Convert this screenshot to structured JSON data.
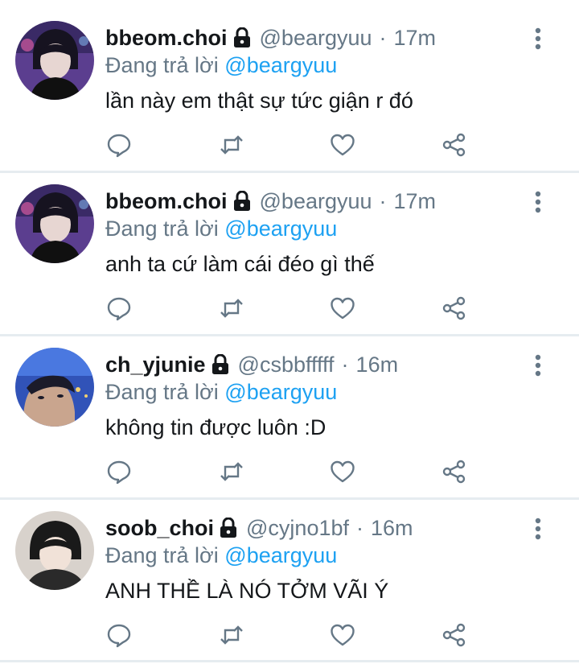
{
  "icons": {
    "lock": "lock-icon",
    "more": "more-vertical-icon",
    "reply": "reply-bubble-icon",
    "retweet": "retweet-icon",
    "like": "heart-icon",
    "share": "share-icon"
  },
  "colors": {
    "text": "#14171a",
    "secondary": "#657786",
    "link": "#1da1f2",
    "divider": "#e6ecf0"
  },
  "tweets": [
    {
      "display_name": "bbeom.choi",
      "handle": "@beargyuu",
      "separator": "·",
      "time": "17m",
      "replying_prefix": "Đang trả lời",
      "replying_to": "@beargyuu",
      "text": "lần này em thật sự tức giận r đó"
    },
    {
      "display_name": "bbeom.choi",
      "handle": "@beargyuu",
      "separator": "·",
      "time": "17m",
      "replying_prefix": "Đang trả lời",
      "replying_to": "@beargyuu",
      "text": "anh ta cứ làm cái đéo gì thế"
    },
    {
      "display_name": "ch_yjunie",
      "handle": "@csbbfffff",
      "separator": "·",
      "time": "16m",
      "replying_prefix": "Đang trả lời",
      "replying_to": "@beargyuu",
      "text": "không tin được luôn :D"
    },
    {
      "display_name": "soob_choi",
      "handle": "@cyjno1bf",
      "separator": "·",
      "time": "16m",
      "replying_prefix": "Đang trả lời",
      "replying_to": "@beargyuu",
      "text": "ANH THỀ LÀ NÓ TỞM VÃI Ý"
    }
  ]
}
